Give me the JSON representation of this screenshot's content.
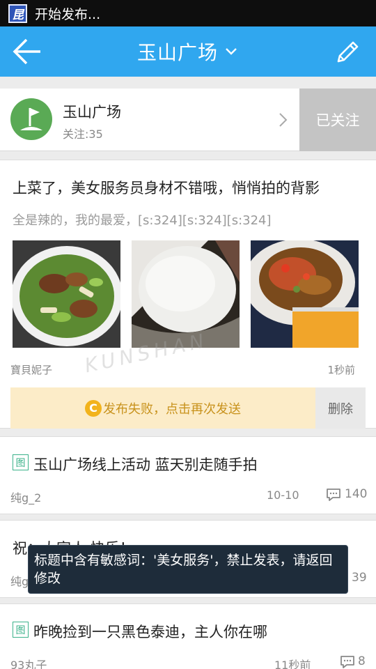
{
  "status_bar": {
    "app_icon_char": "昆",
    "text": "开始发布..."
  },
  "header": {
    "title": "玉山广场"
  },
  "forum": {
    "name": "玉山广场",
    "followers": "关注:35",
    "follow_button": "已关注"
  },
  "pending_post": {
    "title": "上菜了，美女服务员身材不错哦，悄悄拍的背影",
    "excerpt": "全是辣的，我的最爱，[s:324][s:324][s:324]",
    "author": "寶貝妮子",
    "time": "1秒前",
    "watermark": "KUNSHAN",
    "fail_text": "发布失败，点击再次发送",
    "retry_icon_char": "C",
    "delete_label": "删除"
  },
  "posts": [
    {
      "tag": "图",
      "title": "玉山广场线上活动  蓝天别走随手拍",
      "author": "纯g_2",
      "time": "10-10",
      "comments": "140"
    },
    {
      "tag": "",
      "title": "祝：大家人  快乐！",
      "author": "纯g",
      "time": "",
      "comments": "39"
    },
    {
      "tag": "图",
      "title": "昨晚捡到一只黑色泰迪，主人你在哪",
      "author": "93丸子",
      "time": "11秒前",
      "comments": "8"
    }
  ],
  "toast": {
    "text": "标题中含有敏感词：'美女服务'，禁止发表，请返回修改"
  },
  "colors": {
    "header_bg": "#30a7ef",
    "fail_bg": "#fcecc8",
    "tag_green": "#3bb28a",
    "avatar_green": "#5aaa55"
  }
}
